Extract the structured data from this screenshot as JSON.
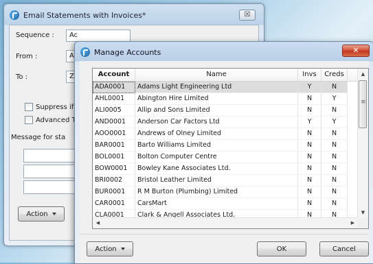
{
  "back_window": {
    "title": "Email Statements with Invoices*",
    "close_glyph": "☒",
    "sequence_label": "Sequence :",
    "sequence_value": "Ac",
    "from_label": "From :",
    "from_value": "AD",
    "to_label": "To :",
    "to_value": "ZE",
    "suppress_label": "Suppress if D",
    "advanced_label": "Advanced Tr",
    "message_label": "Message for sta",
    "action_label": "Action"
  },
  "dialog": {
    "title": "Manage Accounts",
    "close_glyph": "✕",
    "columns": {
      "account": "Account",
      "name": "Name",
      "invs": "Invs",
      "creds": "Creds"
    },
    "rows": [
      {
        "account": "ADA0001",
        "name": "Adams Light Engineering Ltd",
        "invs": "Y",
        "creds": "N"
      },
      {
        "account": "AHL0001",
        "name": "Abington Hire Limited",
        "invs": "N",
        "creds": "Y"
      },
      {
        "account": "ALI0005",
        "name": "Allip and Sons Limited",
        "invs": "N",
        "creds": "N"
      },
      {
        "account": "AND0001",
        "name": "Anderson Car Factors Ltd",
        "invs": "Y",
        "creds": "Y"
      },
      {
        "account": "AOO0001",
        "name": "Andrews of Olney Limited",
        "invs": "N",
        "creds": "N"
      },
      {
        "account": "BAR0001",
        "name": "Barto Williams Limited",
        "invs": "N",
        "creds": "N"
      },
      {
        "account": "BOL0001",
        "name": "Bolton Computer Centre",
        "invs": "N",
        "creds": "N"
      },
      {
        "account": "BOW0001",
        "name": "Bowley Kane Associates Ltd.",
        "invs": "N",
        "creds": "N"
      },
      {
        "account": "BRI0002",
        "name": "Bristol Leather Limited",
        "invs": "N",
        "creds": "N"
      },
      {
        "account": "BUR0001",
        "name": "R M Burton (Plumbing) Limited",
        "invs": "N",
        "creds": "N"
      },
      {
        "account": "CAR0001",
        "name": "CarsMart",
        "invs": "N",
        "creds": "N"
      },
      {
        "account": "CLA0001",
        "name": "Clark & Angell Associates Ltd.",
        "invs": "N",
        "creds": "N"
      }
    ],
    "selected_row": 0,
    "action_label": "Action",
    "ok_label": "OK",
    "cancel_label": "Cancel"
  }
}
